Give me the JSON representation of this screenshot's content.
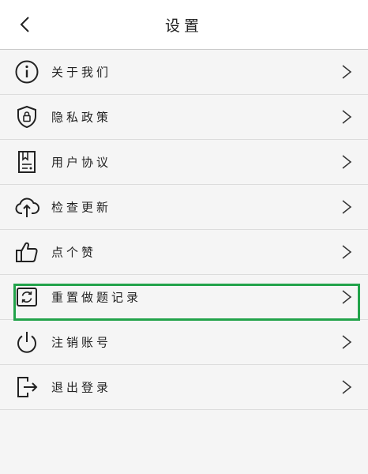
{
  "header": {
    "title": "设置",
    "back_icon": "chevron-left-icon"
  },
  "menu": [
    {
      "label": "关于我们",
      "icon": "info-circle-icon"
    },
    {
      "label": "隐私政策",
      "icon": "shield-lock-icon"
    },
    {
      "label": "用户协议",
      "icon": "document-bookmark-icon"
    },
    {
      "label": "检查更新",
      "icon": "cloud-upload-icon"
    },
    {
      "label": "点个赞",
      "icon": "thumbs-up-icon"
    },
    {
      "label": "重置做题记录",
      "icon": "reset-record-icon",
      "highlighted": true
    },
    {
      "label": "注销账号",
      "icon": "power-icon"
    },
    {
      "label": "退出登录",
      "icon": "logout-icon"
    }
  ],
  "colors": {
    "highlight": "#22a34a",
    "background": "#f5f5f5"
  }
}
